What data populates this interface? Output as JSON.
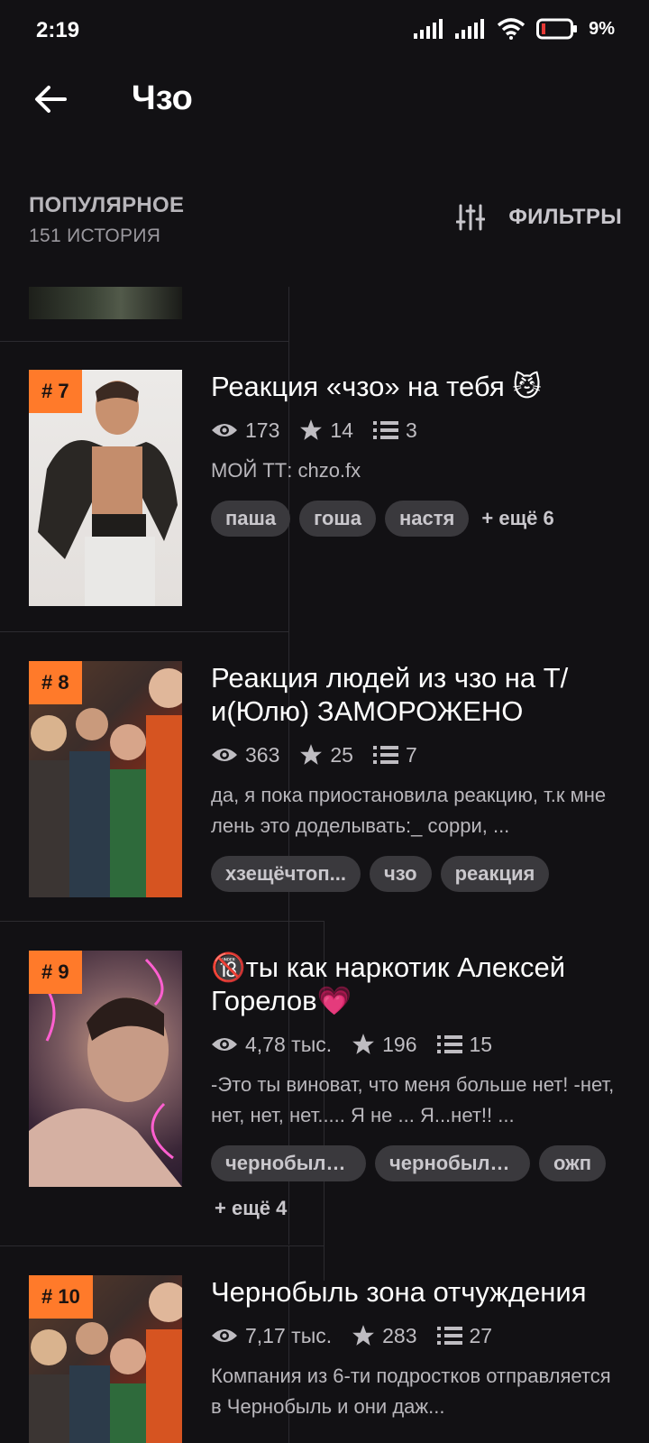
{
  "status": {
    "time": "2:19",
    "battery": "9%"
  },
  "header": {
    "title": "Чзо"
  },
  "sort": {
    "label": "ПОПУЛЯРНОЕ",
    "count": "151 ИСТОРИЯ",
    "filters_label": "ФИЛЬТРЫ"
  },
  "stories": [
    {
      "rank": "# 7",
      "title": "Реакция «чзо» на тебя 😼",
      "views": "173",
      "votes": "14",
      "parts": "3",
      "description": "МОЙ ТТ: chzo.fx",
      "tags": [
        "паша",
        "гоша",
        "настя"
      ],
      "more": "+ ещё 6"
    },
    {
      "rank": "# 8",
      "title": "Реакция людей из чзо на Т/и(Юлю) ЗАМОРОЖЕНО",
      "views": "363",
      "votes": "25",
      "parts": "7",
      "description": "да, я пока приостановила реакцию, т.к мне лень это доделывать:_ сорри, ...",
      "tags": [
        "хзещёчтоп...",
        "чзо",
        "реакция"
      ],
      "more": ""
    },
    {
      "rank": "# 9",
      "title": "🔞ты как наркотик Алексей Горелов💗",
      "views": "4,78 тыс.",
      "votes": "196",
      "parts": "15",
      "description": "-Это ты виноват, что меня больше нет! -нет, нет, нет, нет..... Я не ... Я...нет!! ...",
      "tags": [
        "чернобыль...",
        "чернобыль...",
        "ожп"
      ],
      "more": "+ ещё 4"
    },
    {
      "rank": "# 10",
      "title": "Чернобыль зона отчуждения",
      "views": "7,17 тыс.",
      "votes": "283",
      "parts": "27",
      "description": "Компания из 6-ти подростков отправляется в Чернобыль и они даж...",
      "tags": [],
      "more": ""
    }
  ]
}
